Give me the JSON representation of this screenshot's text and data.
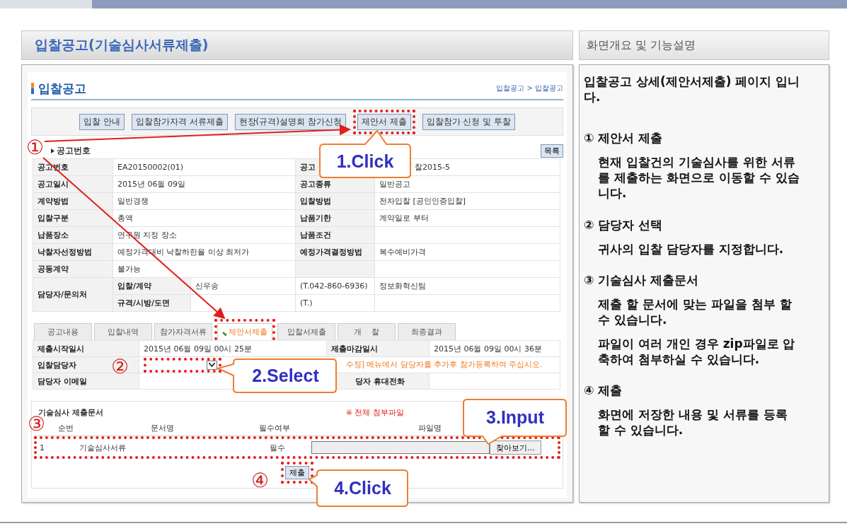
{
  "slide_title": "입찰공고(기술심사서류제출)",
  "panel_title": "화면개요 및 기능설명",
  "screen": {
    "heading": "입찰공고",
    "breadcrumb": "입찰공고 > 입찰공고",
    "nav_buttons": [
      {
        "label": "입찰 안내",
        "highlighted": false
      },
      {
        "label": "입찰참가자격 서류제출",
        "highlighted": false
      },
      {
        "label": "현장(규격)설명회 참가신청",
        "highlighted": false
      },
      {
        "label": "제안서 제출",
        "highlighted": true
      },
      {
        "label": "입찰참가 신청 및 투찰",
        "highlighted": false
      }
    ],
    "section_label": "공고번호",
    "list_button": "목록",
    "info_rows": [
      [
        "공고번호",
        "EA20150002(01)",
        "공고",
        "찰2015-5"
      ],
      [
        "공고일시",
        "2015년 06월 09일",
        "공고종류",
        "일반공고"
      ],
      [
        "계약방법",
        "일반경쟁",
        "입찰방법",
        "전자입찰 [공인인증입찰]"
      ],
      [
        "입찰구분",
        "총액",
        "납품기한",
        "계약일로 부터"
      ],
      [
        "납품장소",
        "연구원 지정 장소",
        "납품조건",
        ""
      ],
      [
        "낙찰자선정방법",
        "예정가격대비 낙찰하한율 이상 최저가",
        "예정가격결정방법",
        "복수예비가격"
      ],
      [
        "공동계약",
        "불가능",
        "",
        ""
      ]
    ],
    "contact": {
      "label": "담당자/문의처",
      "rows": [
        [
          "입찰/계약",
          "신우송",
          "(T.042-860-6936)",
          "정보화혁신팀"
        ],
        [
          "규격/시방/도면",
          "",
          "(T.)",
          ""
        ]
      ]
    },
    "tabs": [
      {
        "label": "공고내용",
        "selected": false,
        "highlighted": false
      },
      {
        "label": "입찰내역",
        "selected": false,
        "highlighted": false
      },
      {
        "label": "참가자격서류",
        "selected": false,
        "highlighted": false
      },
      {
        "label": "제안서제출",
        "selected": true,
        "highlighted": true
      },
      {
        "label": "입찰서제출",
        "selected": false,
        "highlighted": false
      },
      {
        "label": "개    찰",
        "selected": false,
        "highlighted": false
      },
      {
        "label": "최종결과",
        "selected": false,
        "highlighted": false
      }
    ],
    "submission": {
      "start_label": "제출시작일시",
      "start_value": "2015년 06월 09일 00시 25분",
      "end_label": "제출마감일시",
      "end_value": "2015년 06월 09일 00시 36분",
      "manager_label": "입찰담당자",
      "manager_select_highlighted": true,
      "manager_notice": "수정] 메뉴에서 담당자를 추가후 참가등록하여 주십시오.",
      "email_label": "담당자 이메일",
      "phone_label": "당자 휴대전화"
    },
    "documents": {
      "title": "기술심사 제출문서",
      "notice": "※ 전체 첨부파일",
      "columns": [
        "순번",
        "문서명",
        "필수여부",
        "파일명"
      ],
      "rows": [
        {
          "number": "1",
          "name": "기술심사서류",
          "required": "필수",
          "browse_button": "찾아보기...",
          "highlighted": true
        }
      ]
    },
    "submit_button": {
      "label": "제출",
      "highlighted": true
    }
  },
  "annotations": {
    "markers": [
      "①",
      "②",
      "③",
      "④"
    ],
    "callouts": [
      "1.Click",
      "2.Select",
      "3.Input",
      "4.Click"
    ]
  },
  "description": {
    "intro": "입찰공고 상세(제안서제출) 페이지 입니다.",
    "items": [
      {
        "heading": "① 제안서 제출",
        "paragraphs": [
          "현재 입찰건의 기술심사를 위한 서류를 제출하는 화면으로 이동할 수 있습니다."
        ]
      },
      {
        "heading": "② 담당자 선택",
        "paragraphs": [
          "귀사의 입찰 담당자를 지정합니다."
        ]
      },
      {
        "heading": "③ 기술심사 제출문서",
        "paragraphs": [
          "제출 할 문서에 맞는 파일을 첨부 할 수 있습니다.",
          "파일이 여러 개인 경우 zip파일로 압축하여 첨부하실 수 있습니다."
        ]
      },
      {
        "heading": "④ 제출",
        "paragraphs": [
          "화면에 저장한 내용 및 서류를 등록 할 수 있습니다."
        ]
      }
    ]
  }
}
